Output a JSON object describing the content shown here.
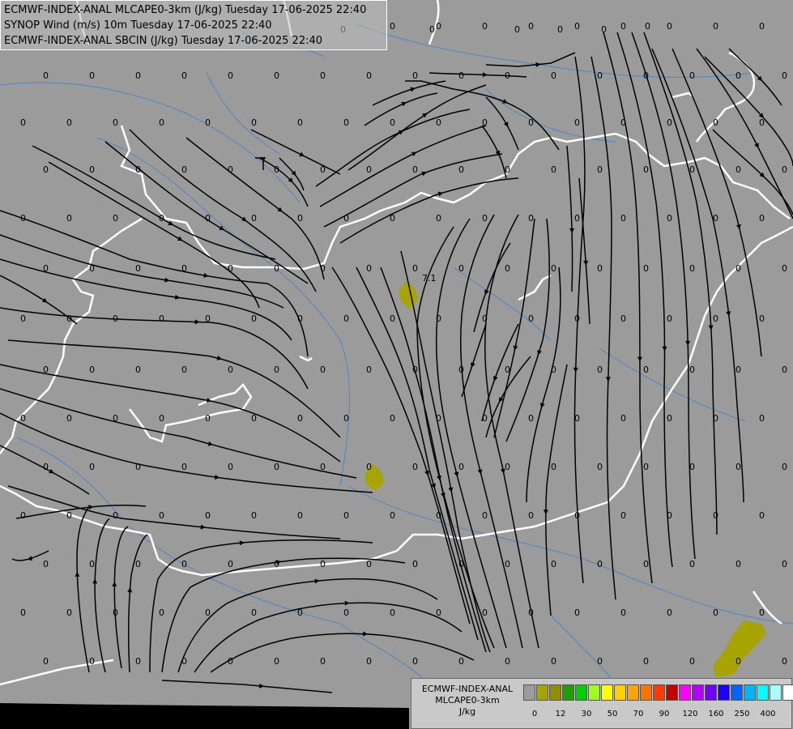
{
  "titles": [
    "ECMWF-INDEX-ANAL MLCAPE0-3km (J/kg) Tuesday 17-06-2025 22:40",
    "SYNOP Wind (m/s) 10m Tuesday 17-06-2025 22:40",
    "ECMWF-INDEX-ANAL SBCIN (J/kg) Tuesday 17-06-2025 22:40"
  ],
  "station_value": "0",
  "peak_label": "7.1",
  "legend": {
    "title_line1": "ECMWF-INDEX-ANAL",
    "title_line2": "MLCAPE0-3km",
    "unit": "J/kg",
    "colors": [
      "#9b9b9b",
      "#a7a400",
      "#8f8f00",
      "#20a000",
      "#00cf00",
      "#9cff1c",
      "#ffff00",
      "#ffcf00",
      "#ffa400",
      "#ff7300",
      "#ff3a00",
      "#c40000",
      "#ff00ff",
      "#b400ff",
      "#7000ff",
      "#2000ff",
      "#0064ff",
      "#00b4ff",
      "#00ffff",
      "#a5ffff",
      "#ffffff"
    ],
    "ticks": [
      "0",
      "12",
      "30",
      "50",
      "70",
      "90",
      "120",
      "160",
      "250",
      "400"
    ]
  },
  "cape_color": "#a7a400",
  "border_color": "#ffffff",
  "river_color": "#4f86c6"
}
